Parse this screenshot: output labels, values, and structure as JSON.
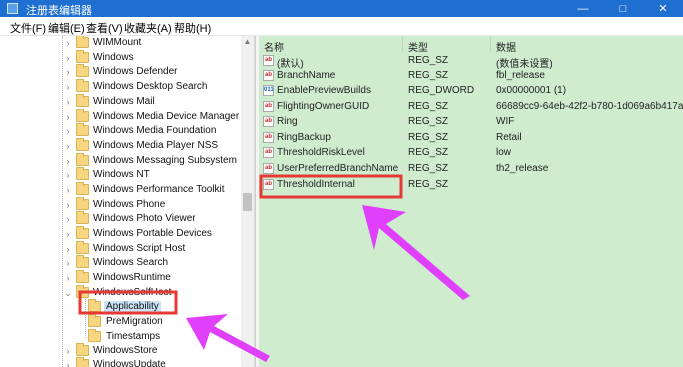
{
  "window": {
    "title": "注册表编辑器"
  },
  "menu": [
    {
      "label": "文件(F)"
    },
    {
      "label": "编辑(E)"
    },
    {
      "label": "查看(V)"
    },
    {
      "label": "收藏夹(A)"
    },
    {
      "label": "帮助(H)"
    }
  ],
  "tree": {
    "items": [
      {
        "label": "WIMMount",
        "expander": "›"
      },
      {
        "label": "Windows",
        "expander": "›"
      },
      {
        "label": "Windows Defender",
        "expander": "›"
      },
      {
        "label": "Windows Desktop Search",
        "expander": "›"
      },
      {
        "label": "Windows Mail",
        "expander": "›"
      },
      {
        "label": "Windows Media Device Manager",
        "expander": "›"
      },
      {
        "label": "Windows Media Foundation",
        "expander": "›"
      },
      {
        "label": "Windows Media Player NSS",
        "expander": "›"
      },
      {
        "label": "Windows Messaging Subsystem",
        "expander": "›"
      },
      {
        "label": "Windows NT",
        "expander": "›"
      },
      {
        "label": "Windows Performance Toolkit",
        "expander": "›"
      },
      {
        "label": "Windows Phone",
        "expander": "›"
      },
      {
        "label": "Windows Photo Viewer",
        "expander": "›"
      },
      {
        "label": "Windows Portable Devices",
        "expander": "›"
      },
      {
        "label": "Windows Script Host",
        "expander": "›"
      },
      {
        "label": "Windows Search",
        "expander": "›"
      },
      {
        "label": "WindowsRuntime",
        "expander": "›"
      },
      {
        "label": "WindowsSelfHost",
        "expander": "⌄"
      },
      {
        "label": "Applicability",
        "expander": ""
      },
      {
        "label": "PreMigration",
        "expander": ""
      },
      {
        "label": "Timestamps",
        "expander": ""
      },
      {
        "label": "WindowsStore",
        "expander": "›"
      },
      {
        "label": "WindowsUpdate",
        "expander": "›"
      }
    ],
    "selected": "Applicability"
  },
  "values": {
    "headers": {
      "name": "名称",
      "type": "类型",
      "data": "数据"
    },
    "rows": [
      {
        "name": "(默认)",
        "type": "REG_SZ",
        "data": "(数值未设置)",
        "icon": "string-value-icon"
      },
      {
        "name": "BranchName",
        "type": "REG_SZ",
        "data": "fbl_release",
        "icon": "string-value-icon"
      },
      {
        "name": "EnablePreviewBuilds",
        "type": "REG_DWORD",
        "data": "0x00000001 (1)",
        "icon": "binary-value-icon"
      },
      {
        "name": "FlightingOwnerGUID",
        "type": "REG_SZ",
        "data": "66689cc9-64eb-42f2-b780-1d069a6b417a",
        "icon": "string-value-icon"
      },
      {
        "name": "Ring",
        "type": "REG_SZ",
        "data": "WIF",
        "icon": "string-value-icon"
      },
      {
        "name": "RingBackup",
        "type": "REG_SZ",
        "data": "Retail",
        "icon": "string-value-icon"
      },
      {
        "name": "ThresholdRiskLevel",
        "type": "REG_SZ",
        "data": "low",
        "icon": "string-value-icon"
      },
      {
        "name": "UserPreferredBranchName",
        "type": "REG_SZ",
        "data": "th2_release",
        "icon": "string-value-icon"
      },
      {
        "name": "ThresholdInternal",
        "type": "REG_SZ",
        "data": "",
        "icon": "string-value-icon"
      }
    ]
  },
  "icons": {
    "string": "ab",
    "binary": "011"
  },
  "colors": {
    "titlebar": "#1f6fd0",
    "values_bg": "#cfeccf",
    "highlight_box": "#e53935",
    "annotation_arrow": "#e040fb"
  }
}
